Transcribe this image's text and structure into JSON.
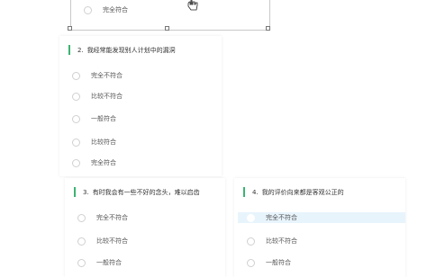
{
  "top_card": {
    "option_label": "完全符合"
  },
  "q2": {
    "number": "2.",
    "text": "我经常能发现别人计划中的漏洞",
    "options": [
      "完全不符合",
      "比较不符合",
      "一般符合",
      "比较符合",
      "完全符合"
    ]
  },
  "q3": {
    "number": "3.",
    "text": "有时我会有一些不好的念头，难以启齿",
    "options": [
      "完全不符合",
      "比较不符合",
      "一般符合"
    ]
  },
  "q4": {
    "number": "4.",
    "text": "我的评价向来都是客观公正的",
    "options": [
      "完全不符合",
      "比较不符合",
      "一般符合"
    ],
    "selected_index": 0
  },
  "accent_color": "#3cb371"
}
